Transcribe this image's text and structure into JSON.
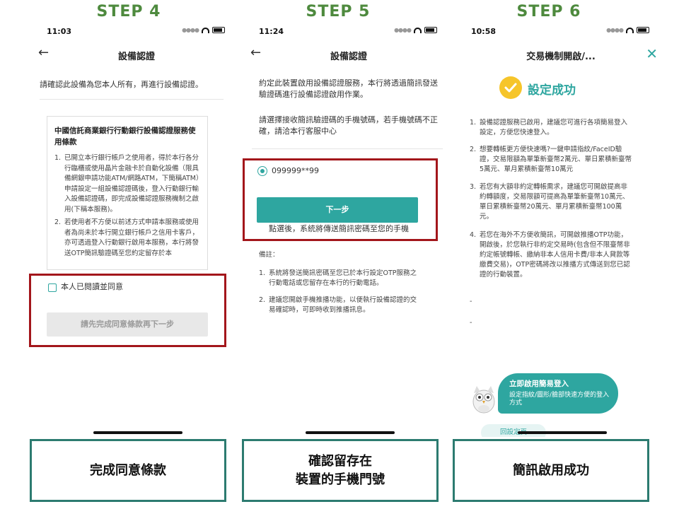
{
  "steps": [
    {
      "label": "STEP 4",
      "caption": "完成同意條款"
    },
    {
      "label": "STEP 5",
      "caption_lines": [
        "確認留存在",
        "裝置的手機門號"
      ]
    },
    {
      "label": "STEP 6",
      "caption": "簡訊啟用成功"
    }
  ],
  "screen4": {
    "time": "11:03",
    "title": "設備認證",
    "intro": "請確認此設備為您本人所有，再進行設備認證。",
    "terms_title": "中國信託商業銀行行動銀行設備認證服務使用條款",
    "terms": [
      {
        "n": "1.",
        "text": "已開立本行銀行帳戶之使用者，得於本行各分行臨櫃或使用晶片金融卡於自動化設備（限具備網銀申請功能ATM/網路ATM，下簡稱ATM）申請設定一組設備認證碼後，登入行動銀行輸入設備認證碼，即完成設備認證服務機制之啟用(下稱本服務)。"
      },
      {
        "n": "2.",
        "text": "若使用者不方便以前述方式申請本服務或使用者為尚未於本行開立銀行帳戶之信用卡客戶，亦可透過登入行動銀行啟用本服務，本行將發送OTP簡訊驗證碼至您約定留存於本"
      }
    ],
    "agree_label": "本人已閱讀並同意",
    "next_button": "請先完成同意條款再下一步"
  },
  "screen5": {
    "time": "11:24",
    "title": "設備認證",
    "intro1": "約定此裝置啟用設備認證服務，本行將透過簡訊發送驗證碼進行設備認證啟用作業。",
    "intro2": "請選擇接收簡訊驗證碼的手機號碼，若手機號碼不正確，請洽本行客服中心",
    "phone": "099999**99",
    "next_button": "下一步",
    "hint": "點選後，系統將傳送簡訊密碼至您的手機",
    "notes_title": "備註：",
    "notes": [
      {
        "n": "1.",
        "text": "系統將發送簡訊密碼至您已於本行設定OTP服務之行動電話或您留存在本行的行動電話。"
      },
      {
        "n": "2.",
        "text": "建議您開啟手機推播功能，以便執行設備認證的交易確認時，可即時收到推播訊息。"
      }
    ]
  },
  "screen6": {
    "time": "10:58",
    "title": "交易機制開啟/...",
    "success": "設定成功",
    "items": [
      {
        "n": "1.",
        "text": "設備認證服務已啟用，建議您可進行各項簡易登入設定，方便您快速登入。"
      },
      {
        "n": "2.",
        "text": "想要轉帳更方便快速嗎?一鍵申請指紋/FaceID驗證，交易限額為單筆新臺幣2萬元、單日累積新臺幣5萬元、單月累積新臺幣10萬元"
      },
      {
        "n": "3.",
        "text": "若您有大額非約定轉帳需求，建議您可開啟提高非約轉額度，交易限額可提高為單筆新臺幣10萬元、單日累積新臺幣20萬元、單月累積新臺幣100萬元。"
      },
      {
        "n": "4.",
        "text": "若您在海外不方便收簡訊，可開啟推播OTP功能，開啟後，於您執行非約定交易時(包含但不限臺幣非約定帳號轉帳、繳納非本人信用卡費/非本人貸款等繳費交易)，OTP密碼將改以推播方式傳送到您已認證的行動裝置。"
      }
    ],
    "dash1": "-",
    "dash2": "-",
    "bubble_title": "立即啟用簡易登入",
    "bubble_sub": "設定指紋/圖形/臉部快速方便的登入方式",
    "pill": "回設定頁"
  },
  "colors": {
    "step_green": "#4e8a3e",
    "teal": "#2ea6a0",
    "highlight_red": "#a3161b",
    "caption_border": "#2c7b70",
    "success_yellow": "#f6c52a"
  }
}
